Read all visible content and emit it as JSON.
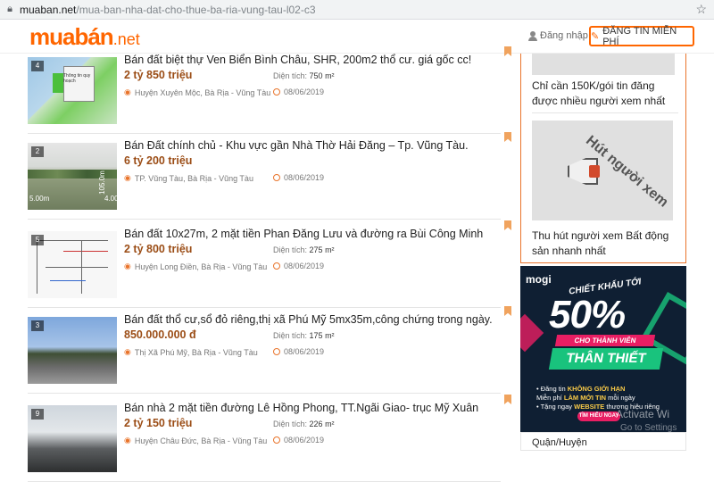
{
  "browser": {
    "url_host": "muaban.net",
    "url_path": "/mua-ban-nha-dat-cho-thue-ba-ria-vung-tau-l02-c3",
    "lock_icon": "lock-icon",
    "star_icon": "star-icon"
  },
  "header": {
    "logo_main": "muabán",
    "logo_suffix": ".net",
    "login_label": "Đăng nhập",
    "post_button_label": "ĐĂNG TIN MIỄN PHÍ",
    "brand_color": "#ff6600"
  },
  "listings": [
    {
      "image_count": "4",
      "title": "Bán đất biệt thự Ven Biển Bình Châu, SHR, 200m2 thổ cư. giá gốc cc!",
      "price": "2 tỷ 850 triệu",
      "area_label": "Diện tích:",
      "area_value": "750 m²",
      "location": "Huyện Xuyên Mộc, Bà Rịa - Vũng Tàu",
      "date": "08/06/2019",
      "thumb_text": "Thông tin quy hoạch"
    },
    {
      "image_count": "2",
      "title": "Bán Đất chính chủ - Khu vực gần Nhà Thờ Hải Đăng – Tp. Vũng Tàu.",
      "price": "6 tỷ 200 triệu",
      "area_label": "",
      "area_value": "",
      "location": "TP. Vũng Tàu, Bà Rịa - Vũng Tàu",
      "date": "08/06/2019",
      "thumb_dim1": "5.00m",
      "thumb_dim2": "105.0m",
      "thumb_dim3": "4.00"
    },
    {
      "image_count": "5",
      "title": "Bán đất 10x27m, 2 mặt tiền Phan Đăng Lưu và đường ra Bùi Công Minh",
      "price": "2 tỷ 800 triệu",
      "area_label": "Diện tích:",
      "area_value": "275 m²",
      "location": "Huyện Long Điền, Bà Rịa - Vũng Tàu",
      "date": "08/06/2019"
    },
    {
      "image_count": "3",
      "title": "Bán đất thổ cư,sổ đỏ riêng,thị xã Phú Mỹ 5mx35m,công chứng trong ngày.",
      "price": "850.000.000 đ",
      "area_label": "Diện tích:",
      "area_value": "175 m²",
      "location": "Thị Xã Phú Mỹ, Bà Rịa - Vũng Tàu",
      "date": "08/06/2019"
    },
    {
      "image_count": "9",
      "title": "Bán nhà 2 mặt tiền đường Lê Hồng Phong, TT.Ngãi Giao- trục Mỹ Xuân",
      "price": "2 tỷ 150 triệu",
      "area_label": "Diện tích:",
      "area_value": "226 m²",
      "location": "Huyện Châu Đức, Bà Rịa - Vũng Tàu",
      "date": "08/06/2019"
    }
  ],
  "sidebar": {
    "promo1_text": "Chỉ cần 150K/gói tin đăng được nhiều người xem nhất",
    "promo2_image_text": "Hút người xem",
    "promo2_text": "Thu hút người xem Bất động sản nhanh nhất",
    "banner": {
      "logo": "mogi",
      "tagline": "CHIẾT KHẤU TỚI",
      "percent": "50%",
      "for_members": "CHO THÀNH VIÊN",
      "member_type": "THÂN THIẾT",
      "line1_pre": "• Đăng tin ",
      "line1_hl": "KHÔNG GIỚI HẠN",
      "line2_pre": "Miễn phí ",
      "line2_hl": "LÀM MỚI TIN",
      "line2_post": " mỗi ngày",
      "line3_pre": "• Tặng ngay ",
      "line3_hl": "WEBSITE",
      "line3_post": " thương hiệu riêng",
      "button": "TÌM HIỂU NGAY"
    },
    "district_label": "Quận/Huyện"
  },
  "os_overlay": {
    "activate": "Activate Wi",
    "goto": "Go to Settings"
  }
}
